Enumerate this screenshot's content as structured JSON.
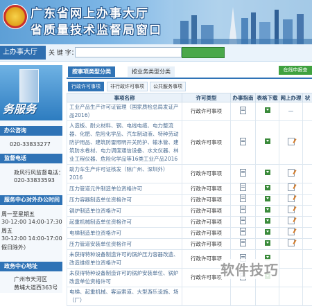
{
  "banner": {
    "line1": "广东省网上办事大厅",
    "line2": "省质量技术监督局窗口"
  },
  "topbar": {
    "home_tab": "上办事大厅",
    "keyword_label": "关 键 字：",
    "keyword_value": "",
    "search_button": ""
  },
  "sidebar": {
    "promo_text": "务服务",
    "blocks": [
      {
        "title": "办公咨询",
        "lines": [
          "020-33833277"
        ]
      },
      {
        "title": "监督电话",
        "lines": [
          "政风行风监督电话：",
          "020-33833593"
        ]
      },
      {
        "title": "服务中心对外办公时间",
        "lines": [
          "周一至星期五",
          "30-12:00 14:00-17:30",
          "周五",
          "30-12:00 14:00-17:00",
          "假日除外）"
        ]
      },
      {
        "title": "政务中心地址",
        "lines": [
          "广州市天河区",
          "黄埔大道西363号"
        ]
      }
    ]
  },
  "main": {
    "type_tabs": [
      "按事项类型分类",
      "按业务类型分类"
    ],
    "green_button": "在线申报查",
    "sub_tabs": [
      "行政许可事项",
      "非行政许可事项",
      "公共服务事项"
    ],
    "columns": [
      "事项名称",
      "许可类型",
      "办事指南",
      "表格下载",
      "网上办理",
      "状"
    ],
    "rows": [
      {
        "name": "工业产品生产许可证管理（国家质检总局发证产品2016）",
        "type": "行政许可事项",
        "online": "—"
      },
      {
        "name": "人造板、耐火材料、钢、电线电缆、电力整流器、化肥、危险化学品、汽车制动液、特种劳动防护用品、建筑防雷照明开关防护、输水管、建筑防水卷材、电力调度通信设备、水文仪器、林业工程仪器、危险化学品等16类工业产品2016",
        "type": "行政许可事项",
        "online": "edit"
      },
      {
        "name": "助力车生产许可证核发（除广州、深圳外）2016",
        "type": "行政许可事项",
        "online": "edit"
      },
      {
        "name": "压力管道元件制造单位资格许可",
        "type": "行政许可事项",
        "online": "edit"
      },
      {
        "name": "压力容器制造单位资格许可",
        "type": "行政许可事项",
        "online": "edit"
      },
      {
        "name": "锅炉制造单位资格许可",
        "type": "行政许可事项",
        "online": "edit"
      },
      {
        "name": "起重机械制造单位资格许可",
        "type": "行政许可事项",
        "online": "edit"
      },
      {
        "name": "电梯制造单位资格许可",
        "type": "行政许可事项",
        "online": "edit"
      },
      {
        "name": "压力管道安装单位资格许可",
        "type": "行政许可事项",
        "online": "edit"
      },
      {
        "name": "未获得特种设备制造许可的锅炉压力容器改造、改造维修单位资格许可",
        "type": "行政许可事项",
        "online": ""
      },
      {
        "name": "未获得特种设备制造许可的锅炉安装单位、锅炉改造单位资格许可",
        "type": "行政许可事项",
        "online": ""
      },
      {
        "name": "电梯、起重机械、客运索道、大型游乐设施、场（厂）",
        "type": "",
        "online": ""
      }
    ]
  },
  "watermark": "软件技巧"
}
